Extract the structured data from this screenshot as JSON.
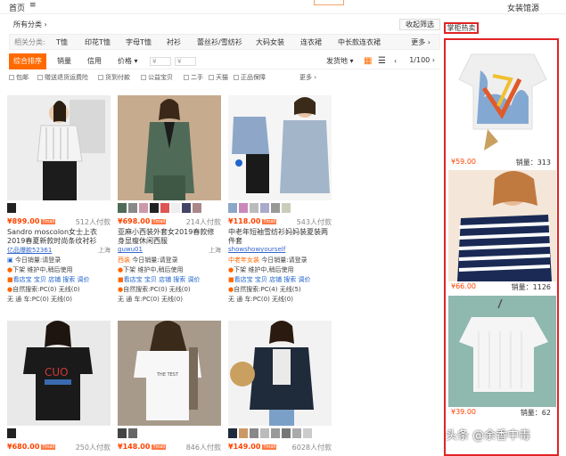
{
  "topbar": {
    "home": "首页",
    "menu_glyph": "≡",
    "right": "女装馆源"
  },
  "crumb": "所有分类 ›",
  "collapse_label": "收起筛选",
  "related": {
    "label": "相关分类:",
    "items": [
      "T恤",
      "印花T恤",
      "字母T恤",
      "衬衫",
      "蕾丝衫/雪纺衫",
      "大码女装",
      "连衣裙",
      "中长款连衣裙"
    ],
    "more": "更多 ›"
  },
  "sort": {
    "items": [
      "综合排序",
      "销量",
      "信用",
      "价格 ▾"
    ],
    "price_from": "¥",
    "price_to": "¥",
    "ship": "发货地 ▾",
    "page": "1/100",
    "prev": "‹",
    "next": "›"
  },
  "filters": [
    "包邮",
    "赠送退货运费险",
    "货到付款",
    "公益宝贝",
    "二手",
    "天猫",
    "正品保障"
  ],
  "filters_more": "更多 ›",
  "products": [
    {
      "price": "¥899.00",
      "paid": "512人付款",
      "title": "Sandro moscolon女士上衣 2019春夏新款时尚条纹衬衫",
      "shop": "亿品爆款52361",
      "loc": "上海",
      "today": "今日销量:请登录",
      "l1": "下架 维护中,稍后使用",
      "l2": "看店宝 宝贝 店铺 搜索 调价",
      "l3": "自然搜索:PC(0) 无线(0)",
      "l4": "无 通 车:PC(0) 无线(0)",
      "tag": "Tmall"
    },
    {
      "price": "¥698.00",
      "paid": "214人付款",
      "title": "亚麻小西装外套女2019春款修身显瘦休闲西服",
      "shop": "guwu01",
      "loc": "上海",
      "today": "今日销量:请登录",
      "l1": "下架 维护中,稍后使用",
      "l2": "看店宝 宝贝 店铺 搜索 调价",
      "l3": "自然搜索:PC(0) 无线(0)",
      "l4": "无 通 车:PC(0) 无线(0)",
      "badge": "西装",
      "tag": "Tmall"
    },
    {
      "price": "¥118.00",
      "paid": "543人付款",
      "title": "中老年短袖雪纺衫妈妈装夏装两件套",
      "shop": "showshowyourself",
      "loc": "",
      "today": "今日销量:请登录",
      "l1": "下架 维护中,稍后使用",
      "l2": "看店宝 宝贝 店铺 搜索 调价",
      "l3": "自然搜索:PC(4) 无线(5)",
      "l4": "无 通 车:PC(0) 无线(0)",
      "badge": "中老年女装",
      "tag": "Tmall"
    },
    {
      "price": "¥680.00",
      "paid": "250人付款",
      "tag": "Tmall"
    },
    {
      "price": "¥148.00",
      "paid": "846人付款",
      "tag": "Tmall"
    },
    {
      "price": "¥149.00",
      "paid": "6028人付款",
      "tag": "Tmall"
    }
  ],
  "hot": {
    "title": "掌柜热卖",
    "items": [
      {
        "price": "¥59.00",
        "sales": "销量：313"
      },
      {
        "price": "¥66.00",
        "sales": "销量：1126"
      },
      {
        "price": "¥39.00",
        "sales": "销量：62"
      }
    ]
  },
  "watermark": "头条 @余香中毒"
}
